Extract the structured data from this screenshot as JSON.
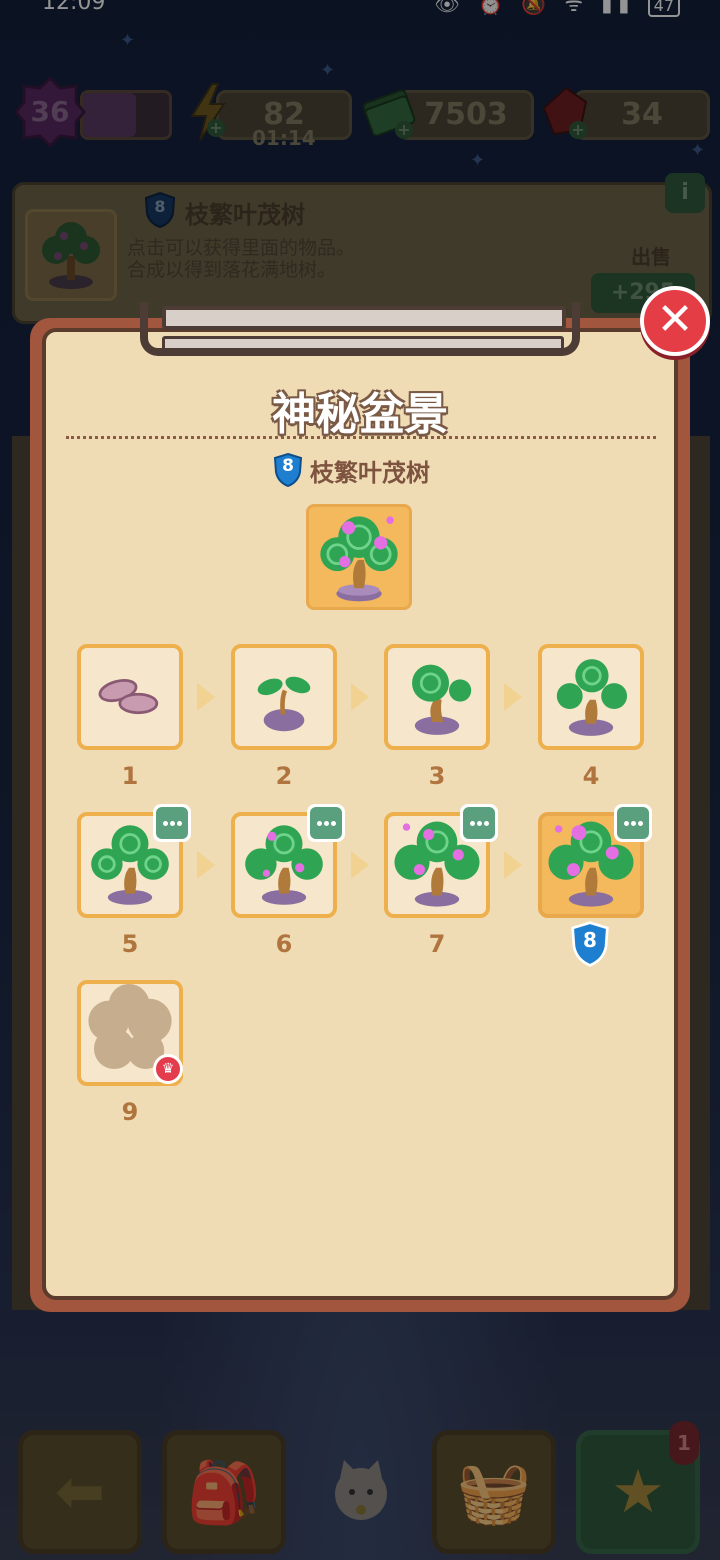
{
  "status_bar": {
    "time": "12:09",
    "battery": "47"
  },
  "resources": {
    "level": "36",
    "energy": "82",
    "energy_timer": "01:14",
    "cash": "7503",
    "gems": "34"
  },
  "item_info": {
    "level": "8",
    "name": "枝繁叶茂树",
    "description": "点击可以获得里面的物品。\n合成以得到落花满地树。",
    "sell_label": "出售",
    "sell_value": "+295",
    "info_icon": "i"
  },
  "modal": {
    "title": "神秘盆景",
    "subtitle_level": "8",
    "subtitle": "枝繁叶茂树",
    "close_icon": "close-icon",
    "chain": [
      {
        "num": "1",
        "icon": "stones-icon"
      },
      {
        "num": "2",
        "icon": "sprout-icon"
      },
      {
        "num": "3",
        "icon": "small-bonsai-icon"
      },
      {
        "num": "4",
        "icon": "bonsai-icon"
      },
      {
        "num": "5",
        "icon": "bushy-bonsai-icon",
        "has_more": true
      },
      {
        "num": "6",
        "icon": "budding-bonsai-icon",
        "has_more": true
      },
      {
        "num": "7",
        "icon": "blooming-bonsai-icon",
        "has_more": true
      },
      {
        "num": "8",
        "icon": "flourishing-bonsai-icon",
        "has_more": true,
        "selected": true
      },
      {
        "num": "9",
        "icon": "locked-silhouette-icon",
        "locked": true
      }
    ],
    "selected_level": "8"
  },
  "colors": {
    "panel_bg": "#efdcb5",
    "panel_frame": "#a3563e",
    "tile_border": "#eeb04d",
    "selected_tile": "#f3b95c",
    "number_text": "#b0753f",
    "close_red": "#e43d46",
    "shield_blue": "#1e7fd1"
  },
  "nav": {
    "count_badge": "1"
  }
}
